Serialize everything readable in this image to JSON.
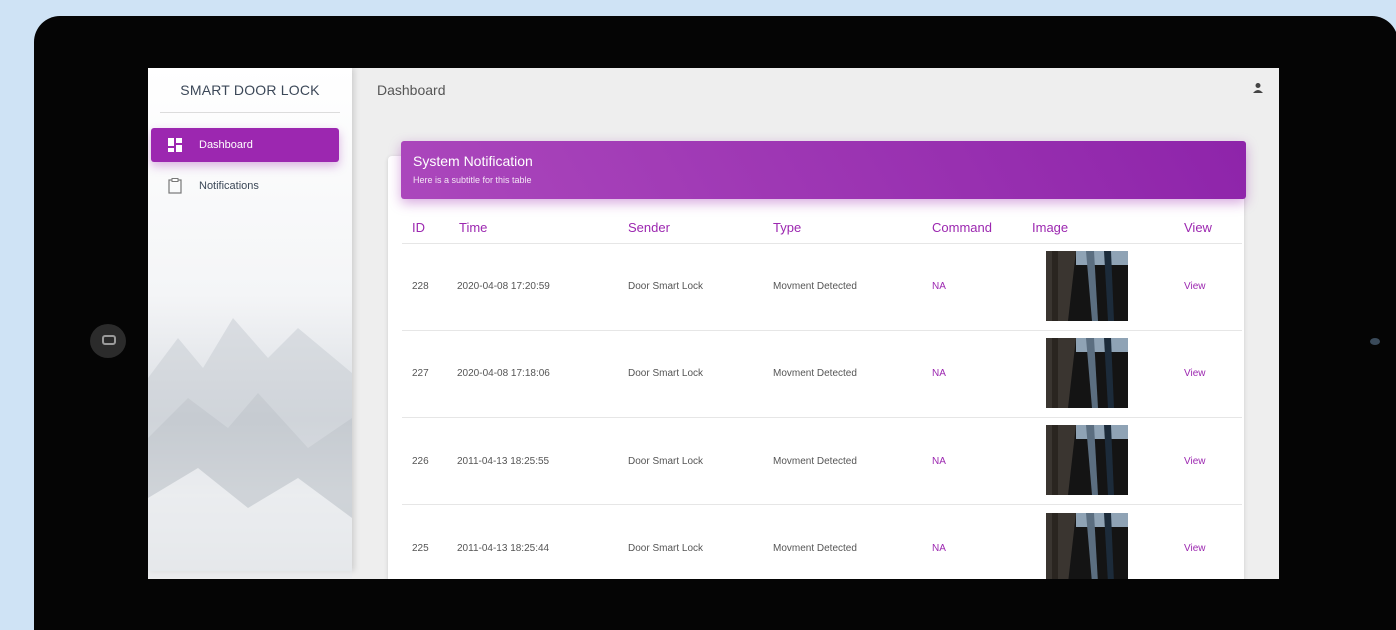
{
  "app": {
    "brand": "SMART DOOR LOCK",
    "page_title": "Dashboard"
  },
  "sidebar": {
    "items": [
      {
        "label": "Dashboard",
        "icon": "dashboard-icon",
        "active": true
      },
      {
        "label": "Notifications",
        "icon": "clipboard-icon",
        "active": false
      }
    ]
  },
  "card": {
    "title": "System Notification",
    "subtitle": "Here is a subtitle for this table"
  },
  "table": {
    "headers": [
      "ID",
      "Time",
      "Sender",
      "Type",
      "Command",
      "Image",
      "View"
    ],
    "rows": [
      {
        "id": "228",
        "time": "2020-04-08 17:20:59",
        "sender": "Door Smart Lock",
        "type": "Movment Detected",
        "command": "NA",
        "view": "View"
      },
      {
        "id": "227",
        "time": "2020-04-08 17:18:06",
        "sender": "Door Smart Lock",
        "type": "Movment Detected",
        "command": "NA",
        "view": "View"
      },
      {
        "id": "226",
        "time": "2011-04-13 18:25:55",
        "sender": "Door Smart Lock",
        "type": "Movment Detected",
        "command": "NA",
        "view": "View"
      },
      {
        "id": "225",
        "time": "2011-04-13 18:25:44",
        "sender": "Door Smart Lock",
        "type": "Movment Detected",
        "command": "NA",
        "view": "View"
      }
    ]
  },
  "colors": {
    "accent": "#9c27b0",
    "bezel": "#050505",
    "background": "#cfe3f5"
  }
}
